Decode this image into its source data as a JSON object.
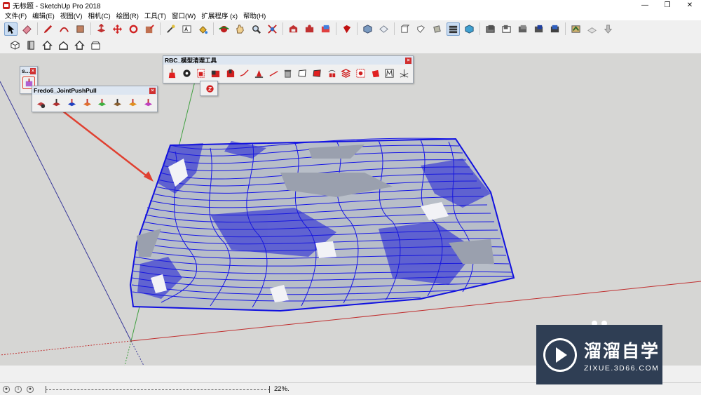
{
  "window": {
    "title": "无标题 - SketchUp Pro 2018",
    "minimize": "—",
    "restore": "❐",
    "close": "✕"
  },
  "menu": [
    {
      "label": "文件(F)"
    },
    {
      "label": "编辑(E)"
    },
    {
      "label": "视图(V)"
    },
    {
      "label": "相机(C)"
    },
    {
      "label": "绘图(R)"
    },
    {
      "label": "工具(T)"
    },
    {
      "label": "窗口(W)"
    },
    {
      "label": "扩展程序 (x)"
    },
    {
      "label": "帮助(H)"
    }
  ],
  "toolbars": {
    "main": [
      "select-icon",
      "eraser-icon",
      "pencil-icon",
      "arc-icon",
      "rectangle-icon",
      "pushpull-icon",
      "move-icon",
      "rotate-icon",
      "scale-icon",
      "tape-icon",
      "text-icon",
      "paint-icon",
      "orbit-icon",
      "pan-icon",
      "zoom-icon",
      "zoom-extents-icon",
      "warehouse-icon",
      "extension-icon",
      "layout-icon",
      "ruby-icon",
      "iso-icon",
      "top-icon",
      "front-icon",
      "right-icon",
      "back-icon",
      "left-icon",
      "xray-icon",
      "shaded-icon",
      "section-icon",
      "section-cut-icon",
      "section-fill-icon",
      "section-planes-icon",
      "display-icon",
      "fog-icon",
      "sandbox-icon",
      "drape-icon"
    ],
    "views": [
      "iso-view-icon",
      "top-view-icon",
      "front-view-icon",
      "right-view-icon",
      "back-view-icon",
      "left-view-icon"
    ]
  },
  "float_small": {
    "title": "s..."
  },
  "float_fredo": {
    "title": "Fredo6_JointPushPull"
  },
  "float_rbc": {
    "title": "RBC_模型清理工具"
  },
  "status": {
    "zoom": "22%."
  },
  "watermark": {
    "cn": "溜溜自学",
    "en": "ZIXUE.3D66.COM"
  },
  "colors": {
    "contour": "#1616e6",
    "background": "#d6d6d4",
    "red_axis": "#c03030",
    "green_axis": "#30a030",
    "blue_axis": "#3030a0",
    "arrow": "#e04030"
  }
}
